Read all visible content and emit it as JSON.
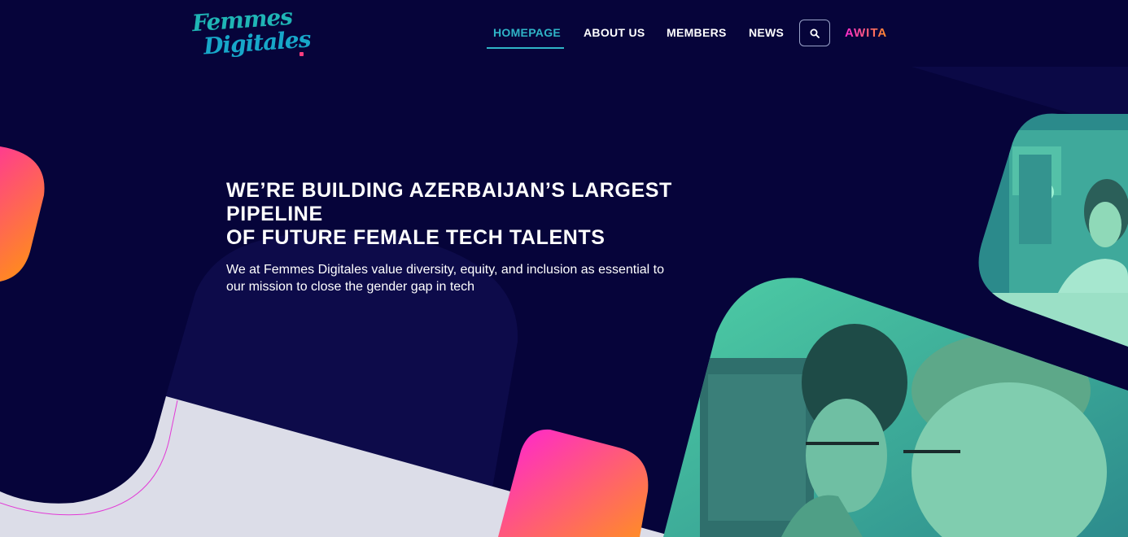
{
  "brand": {
    "logo_line1": "Femmes",
    "logo_line2": "Digitales",
    "colors": {
      "background": "#06043a",
      "accent": "#2fb4c7",
      "gradient_start": "#ff2bd1",
      "gradient_end": "#ff8a2b"
    }
  },
  "nav": {
    "items": [
      {
        "label": "HOMEPAGE",
        "active": true
      },
      {
        "label": "ABOUT US",
        "active": false
      },
      {
        "label": "MEMBERS",
        "active": false
      },
      {
        "label": "NEWS",
        "active": false
      }
    ],
    "search_icon": "search-icon",
    "partner_label": "AWITA"
  },
  "hero": {
    "title_line1": "WE’RE BUILDING AZERBAIJAN’S LARGEST PIPELINE",
    "title_line2": "OF FUTURE FEMALE TECH TALENTS",
    "subtitle_line1": "We at Femmes Digitales value diversity, equity, and inclusion as essential to",
    "subtitle_line2": "our mission to close the gender gap in tech"
  },
  "images": [
    {
      "name": "woman-thinking-photo"
    },
    {
      "name": "women-at-computer-photo"
    }
  ]
}
